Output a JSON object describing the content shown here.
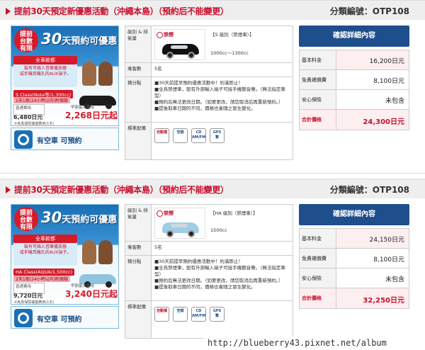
{
  "listings": [
    {
      "title": "提前30天預定新優惠活動（沖繩本島）（預約后不能變更）",
      "code_label": "分類編號：",
      "code": "OTP108",
      "promo": {
        "badge": "提前\n台數\n有限",
        "headline_big": "30",
        "headline": "天預約可優惠!",
        "feature_title": "全車款都",
        "feature_desc": "裝有可插入音樂播放器\n或手機耳機孔的AUX端子。",
        "class_label": "S Class(Note等/1,300cc)",
        "duration": "2天1夜(24小時以内)附保險",
        "old_label": "普通費用",
        "old_price": "6,480日元",
        "new_label": "早割基本費用",
        "new_price": "2,268日元起",
        "note": "※免責保險補償費用(1天)",
        "car_color": "#1b1b1b"
      },
      "availability": "有空車 可預約",
      "details": {
        "car_label": "級別 & 排氣量",
        "no_smoking": "禁煙",
        "class_text": "【S  級別（禁煙車）】",
        "cc": "1000cc～1300cc",
        "car_color": "#111111",
        "pax_label": "乘客數",
        "pax": "5名",
        "points_label": "積分點",
        "points": [
          "■30天前提早預約優惠活動中！約滿即止！",
          "■全爲禁煙車，配有外部輸入端子可接手機聽音樂。（無法指定車型）",
          "■預約后無法更改日期。（如要更改，請您取消后再重新預約。）",
          "■提後取車日期的不同，價格也會隨之發生變化。"
        ],
        "equipment_label": "標準配備",
        "equipment": [
          {
            "icon": "automatic-icon",
            "label": "自動擋"
          },
          {
            "icon": "air-conditioner-icon",
            "label": "空調"
          },
          {
            "icon": "cd-radio-icon",
            "label": "CD\nAM/FM"
          },
          {
            "icon": "gps-icon",
            "label": "GPS\n繁"
          }
        ]
      },
      "cta": "確認詳細內容",
      "pricing": {
        "base_label": "基本料金",
        "base": "16,200日元",
        "insurance_label": "免責補償費",
        "insurance": "8,100日元",
        "safety_label": "安心保險",
        "safety": "未包含",
        "total_label": "合計價格",
        "total": "24,300日元"
      }
    },
    {
      "title": "提前30天預定新優惠活動（沖繩本島）（預約后不能變更）",
      "code_label": "分類編號：",
      "code": "OTP108",
      "promo": {
        "badge": "提前\n台數\n有限",
        "headline_big": "30",
        "headline": "天預約可優惠!",
        "feature_title": "全車款都",
        "feature_desc": "裝有可插入音樂播放器\n或手機耳機孔的AUX端子。",
        "class_label": "HA Class(AQUA/1,500cc)",
        "duration": "2天1夜(24小時以内)附保險",
        "old_label": "普通費用",
        "old_price": "9,720日元",
        "new_label": "早割基本費用",
        "new_price": "3,240日元起",
        "note": "※免責保險補償費用(1天)",
        "car_color": "#8fc3e0"
      },
      "availability": "有空車 可預約",
      "details": {
        "car_label": "級別 & 排氣量",
        "no_smoking": "禁煙",
        "class_text": "【HA  級別（禁煙車）】",
        "cc": "1500cc",
        "car_color": "#9fcde6",
        "pax_label": "乘客數",
        "pax": "5名",
        "points_label": "積分點",
        "points": [
          "■30天前提早預約優惠活動中！約滿即止！",
          "■全爲禁煙車，配有外部輸入端子可接手機聽音樂。（無法指定車型）",
          "■預約后無法更改日期。（如要更改，請您取消后再重新預約。）",
          "■提後取車日期的不同，價格也會隨之發生變化。"
        ],
        "equipment_label": "標準配備",
        "equipment": [
          {
            "icon": "automatic-icon",
            "label": "自動擋"
          },
          {
            "icon": "air-conditioner-icon",
            "label": "空調"
          },
          {
            "icon": "cd-radio-icon",
            "label": "CD\nAM/FM"
          },
          {
            "icon": "gps-icon",
            "label": "GPS\n繁"
          }
        ]
      },
      "cta": "確認詳細內容",
      "pricing": {
        "base_label": "基本料金",
        "base": "24,150日元",
        "insurance_label": "免責補償費",
        "insurance": "8,100日元",
        "safety_label": "安心保險",
        "safety": "未包含",
        "total_label": "合計價格",
        "total": "32,250日元"
      }
    }
  ],
  "watermark": "http://blueberry43.pixnet.net/album"
}
